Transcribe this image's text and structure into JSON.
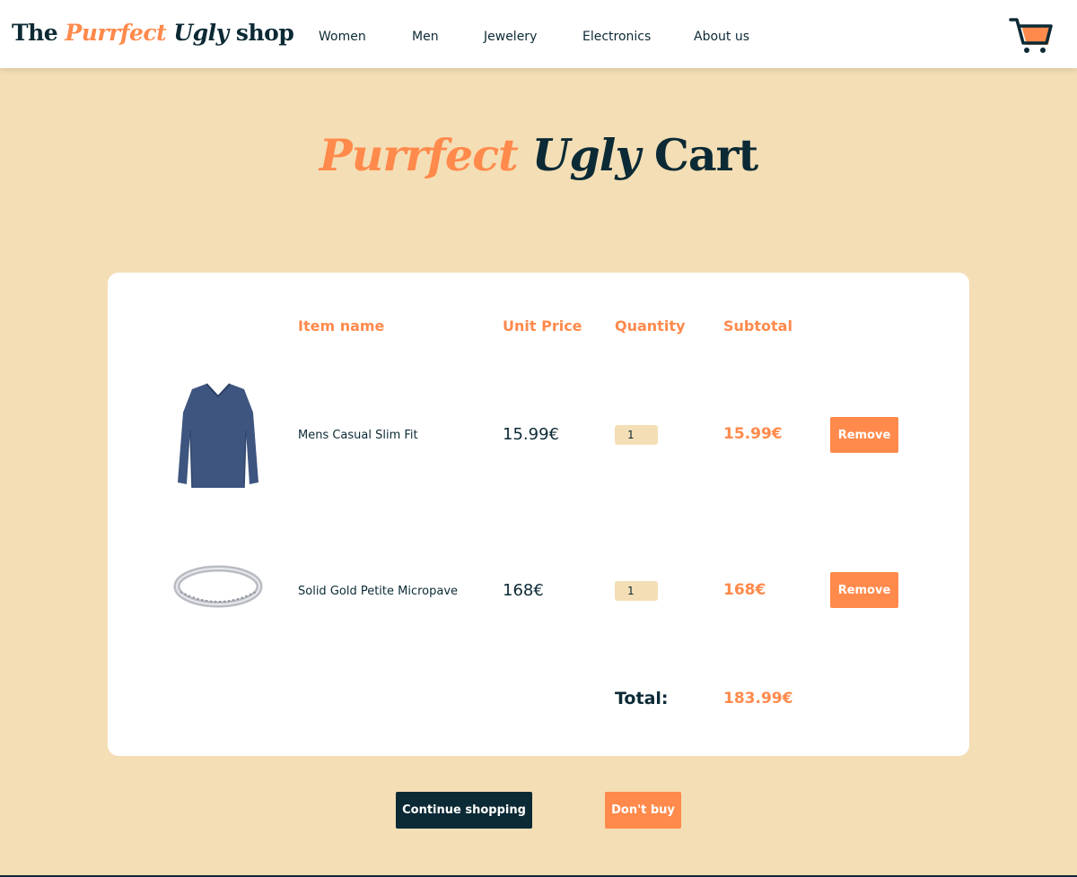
{
  "brand": {
    "logo_the": "The",
    "logo_purrfect": "Purrfect",
    "logo_ugly": "Ugly",
    "logo_shop": "shop",
    "accent_color": "#ff8a4c",
    "dark_color": "#0c2a35",
    "background_color": "#f4deb5"
  },
  "nav": {
    "items": [
      "Women",
      "Men",
      "Jewelery",
      "Electronics",
      "About us"
    ]
  },
  "header": {
    "cart_icon": "shopping-cart-icon"
  },
  "title": {
    "purrfect": "Purrfect",
    "ugly": "Ugly",
    "cart": "Cart"
  },
  "table": {
    "headers": {
      "item_name": "Item name",
      "unit_price": "Unit Price",
      "quantity": "Quantity",
      "subtotal": "Subtotal"
    },
    "rows": [
      {
        "image": "long-sleeve-shirt-image",
        "name": "Mens Casual Slim Fit",
        "unit_price": "15.99€",
        "quantity": "1",
        "subtotal": "15.99€",
        "remove_label": "Remove"
      },
      {
        "image": "ring-image",
        "name": "Solid Gold Petite Micropave",
        "unit_price": "168€",
        "quantity": "1",
        "subtotal": "168€",
        "remove_label": "Remove"
      }
    ],
    "total_label": "Total:",
    "total_value": "183.99€"
  },
  "actions": {
    "continue_label": "Continue shopping",
    "dont_buy_label": "Don't buy"
  }
}
